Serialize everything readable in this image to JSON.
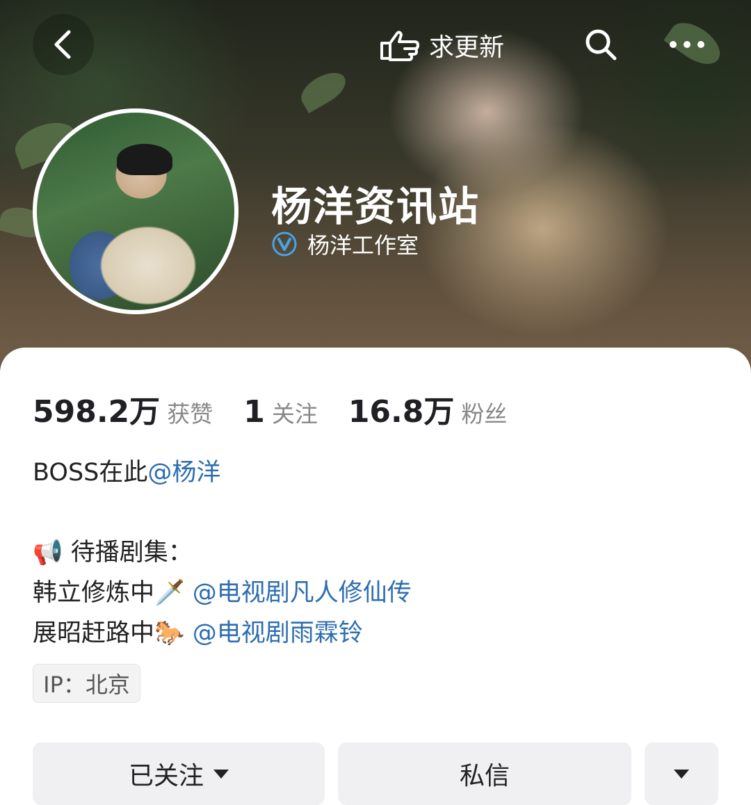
{
  "topbar": {
    "back_icon": "chevron-left-icon",
    "request_update_icon": "pointing-hand-icon",
    "request_update_label": "求更新",
    "search_icon": "search-icon",
    "more_icon": "more-horizontal-icon"
  },
  "profile": {
    "name": "杨洋资讯站",
    "verified_icon": "verified-v-icon",
    "verified_org": "杨洋工作室"
  },
  "stats": [
    {
      "value": "598.2万",
      "label": "获赞"
    },
    {
      "value": "1",
      "label": "关注"
    },
    {
      "value": "16.8万",
      "label": "粉丝"
    }
  ],
  "bio": {
    "line1_text": "BOSS在此",
    "line1_mention": "@杨洋",
    "line2_emoji": "📢",
    "line2_text": " 待播剧集：",
    "line3_text": "韩立修炼中",
    "line3_emoji": "🗡️",
    "line3_mention": " @电视剧凡人修仙传",
    "line4_text": "展昭赶路中",
    "line4_emoji": "🐎",
    "line4_mention": " @电视剧雨霖铃"
  },
  "ip_tag": "IP：北京",
  "actions": {
    "follow_label": "已关注",
    "message_label": "私信"
  },
  "colors": {
    "link": "#2d6db0",
    "verified": "#4aa3e6"
  }
}
